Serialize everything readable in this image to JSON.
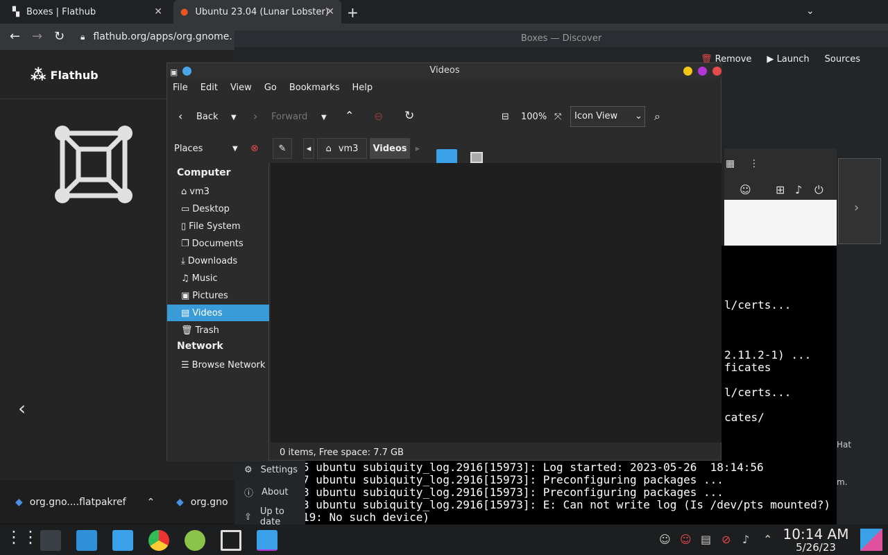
{
  "browser": {
    "tabs": [
      {
        "label": "Boxes | Flathub"
      },
      {
        "label": "Ubuntu 23.04 (Lunar Lobster)"
      }
    ],
    "url": "flathub.org/apps/org.gnome.",
    "site_name": "Flathub",
    "downloads": [
      {
        "label": "org.gno....flatpakref"
      },
      {
        "label": "org.gno"
      }
    ]
  },
  "discover": {
    "title": "Boxes — Discover",
    "remove_label": "Remove",
    "launch_label": "Launch",
    "sources_label": "Sources",
    "menu": [
      {
        "label": "Settings"
      },
      {
        "label": "About"
      },
      {
        "label": "Up to date"
      }
    ]
  },
  "terminal": {
    "right_lines": [
      "l/certs...",
      "2.11.2-1) ...",
      "ficates",
      "l/certs...",
      "cates/"
    ],
    "bottom_lines": [
      "5 ubuntu subiquity_log.2916[15973]: Log started: 2023-05-26  18:14:56",
      "7 ubuntu subiquity_log.2916[15973]: Preconfiguring packages ...",
      "3 ubuntu subiquity_log.2916[15973]: Preconfiguring packages ...",
      "3 ubuntu subiquity_log.2916[15973]: E: Can not write log (Is /dev/pts mounted?) -",
      "19: No such device)"
    ],
    "side_text": [
      "Hat",
      "m."
    ]
  },
  "nemo": {
    "title": "Videos",
    "menus": [
      "File",
      "Edit",
      "View",
      "Go",
      "Bookmarks",
      "Help"
    ],
    "back_label": "Back",
    "forward_label": "Forward",
    "zoom": "100%",
    "view_mode": "Icon View",
    "places_label": "Places",
    "breadcrumbs": [
      "vm3",
      "Videos"
    ],
    "sidebar": {
      "computer_header": "Computer",
      "computer_items": [
        {
          "label": "vm3",
          "icon": "home-icon"
        },
        {
          "label": "Desktop",
          "icon": "desktop-icon"
        },
        {
          "label": "File System",
          "icon": "drive-icon"
        },
        {
          "label": "Documents",
          "icon": "documents-icon"
        },
        {
          "label": "Downloads",
          "icon": "download-icon"
        },
        {
          "label": "Music",
          "icon": "music-icon"
        },
        {
          "label": "Pictures",
          "icon": "pictures-icon"
        },
        {
          "label": "Videos",
          "icon": "video-icon"
        },
        {
          "label": "Trash",
          "icon": "trash-icon"
        }
      ],
      "network_header": "Network",
      "network_items": [
        {
          "label": "Browse Network",
          "icon": "network-icon"
        }
      ]
    },
    "selected_item": "Videos",
    "status": "0 items, Free space: 7.7 GB"
  },
  "taskbar": {
    "time": "10:14 AM",
    "date": "5/26/23"
  },
  "colors": {
    "accent": "#3a9bd9",
    "close": "#e64a4a",
    "minimize": "#f5c518",
    "maximize": "#b536d6"
  }
}
